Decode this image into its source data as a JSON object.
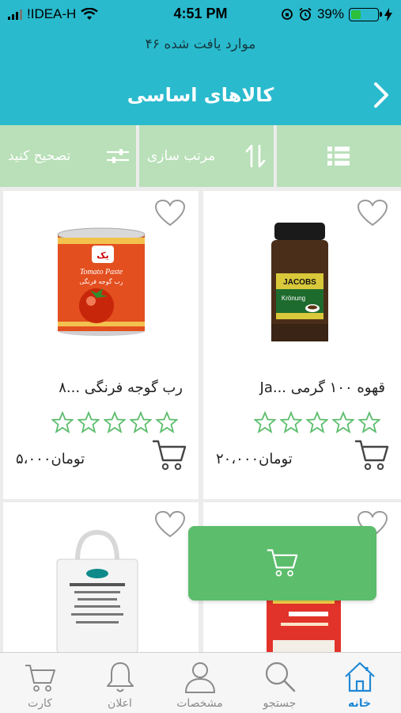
{
  "status_bar": {
    "carrier": "!IDEA-H",
    "time": "4:51 PM",
    "battery": "39%",
    "battery_level": 0.39
  },
  "header": {
    "count_text": "۴۶ موارد یافت شده",
    "title": "کالاهای اساسی",
    "back_icon": "chevron-right-icon"
  },
  "toolbar": {
    "edit_label": "تصحیح کنید",
    "sort_label": "مرتب سازی",
    "view_icon": "list-icon"
  },
  "products": [
    {
      "name": "رب گوجه فرنگی ...۸",
      "price": "۵،۰۰۰تومان",
      "rating": 0,
      "image": "tomato-paste-can"
    },
    {
      "name": "قهوه ۱۰۰ گرمی ...Ja",
      "price": "۲۰،۰۰۰تومان",
      "rating": 0,
      "image": "jacobs-coffee-jar"
    },
    {
      "name": "",
      "price": "",
      "image": "rice-bag"
    },
    {
      "name": "",
      "price": "",
      "image": "red-rice-bag"
    }
  ],
  "tabbar": {
    "tabs": [
      {
        "label": "کارت",
        "icon": "cart-icon"
      },
      {
        "label": "اعلان",
        "icon": "bell-icon"
      },
      {
        "label": "مشخصات",
        "icon": "user-icon"
      },
      {
        "label": "جستجو",
        "icon": "search-icon"
      },
      {
        "label": "خانه",
        "icon": "home-icon"
      }
    ],
    "active_tab": "خانه"
  },
  "colors": {
    "primary": "#29bacd",
    "toolbar": "#b9e0b8",
    "accent": "#5cbd6c",
    "star": "#5cbd6c",
    "active_tab": "#1e88d6"
  }
}
